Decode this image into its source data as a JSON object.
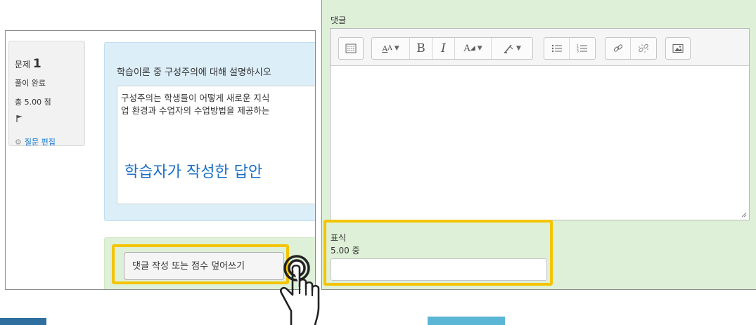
{
  "question_panel": {
    "number_label": "문제",
    "number_value": "1",
    "status": "풀이 완료",
    "score": "총 5.00 점",
    "flag_icon": "flag-icon",
    "edit_label": "질문 편집",
    "question_text": "학습이론 중 구성주의에 대해 설명하시오",
    "answer_line1": "구성주의는 학생들이 어떻게 새로운 지식",
    "answer_line2": "업 환경과 수업자의 수업방법을 제공하는",
    "answer_overlay_label": "학습자가 작성한 답안",
    "comment_button_label": "댓글 작성 또는 점수 덮어쓰기"
  },
  "grading_panel": {
    "comment_label": "댓글",
    "toolbar_icons": [
      "toolbar-toggle-icon",
      "font-size-icon",
      "bold-icon",
      "italic-icon",
      "font-color-icon",
      "background-color-icon",
      "unordered-list-icon",
      "ordered-list-icon",
      "link-icon",
      "unlink-icon",
      "image-icon"
    ],
    "score_label": "표식",
    "score_max": "5.00 중",
    "score_value": ""
  },
  "colors": {
    "highlight": "#f5c400",
    "question_bg": "#dceef8",
    "comment_bg": "#dff0d8",
    "overlay_text": "#1a6fc6"
  }
}
